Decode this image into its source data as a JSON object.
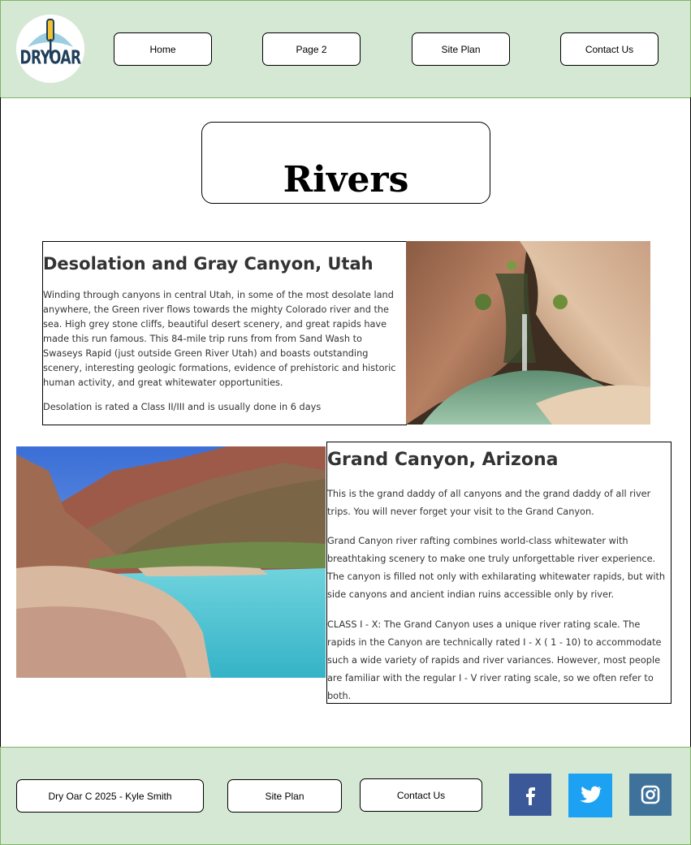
{
  "header": {
    "logo_alt": "Dry Oar",
    "nav": [
      {
        "label": "Home"
      },
      {
        "label": "Page 2"
      },
      {
        "label": "Site Plan"
      },
      {
        "label": "Contact Us"
      }
    ]
  },
  "page": {
    "title": "Rivers"
  },
  "sections": [
    {
      "heading": "Desolation and Gray Canyon, Utah",
      "paragraphs": [
        "Winding through canyons in central Utah, in some of the most desolate land anywhere, the Green river flows towards the mighty Colorado river and the sea. High grey stone cliffs, beautiful desert scenery, and great rapids have made this run famous. This 84-mile trip runs from from Sand Wash to Swaseys Rapid (just outside Green River Utah) and boasts outstanding scenery, interesting geologic formations, evidence of prehistoric and historic human activity, and great whitewater opportunities.",
        "Desolation is rated a Class II/III and is usually done in 6 days"
      ]
    },
    {
      "heading": "Grand Canyon, Arizona",
      "paragraphs": [
        "This is the grand daddy of all canyons and the grand daddy of all river trips. You will never forget your visit to the Grand Canyon.",
        "Grand Canyon river rafting combines world-class whitewater with breathtaking scenery to make one truly unforgettable river experience. The canyon is filled not only with exhilarating whitewater rapids, but with side canyons and ancient indian ruins accessible only by river.",
        "CLASS I - X: The Grand Canyon uses a unique river rating scale. The rapids in the Canyon are technically rated I - X ( 1 - 10) to accommodate such a wide variety of rapids and river variances. However, most people are familiar with the regular I - V river rating scale, so we often refer to both."
      ]
    }
  ],
  "footer": {
    "copyright": "Dry Oar C 2025 - Kyle Smith",
    "site_plan": "Site Plan",
    "contact": "Contact Us",
    "social": [
      {
        "icon": "facebook-icon",
        "color": "#3b5998"
      },
      {
        "icon": "twitter-icon",
        "color": "#1da1f2"
      },
      {
        "icon": "instagram-icon",
        "color": "#3f729b"
      }
    ]
  },
  "colors": {
    "band_fill": "#d5e8d4",
    "band_stroke": "#82b366",
    "text": "#333333",
    "logo_blue": "#1f3f5a",
    "logo_light": "#8fc9dd"
  }
}
